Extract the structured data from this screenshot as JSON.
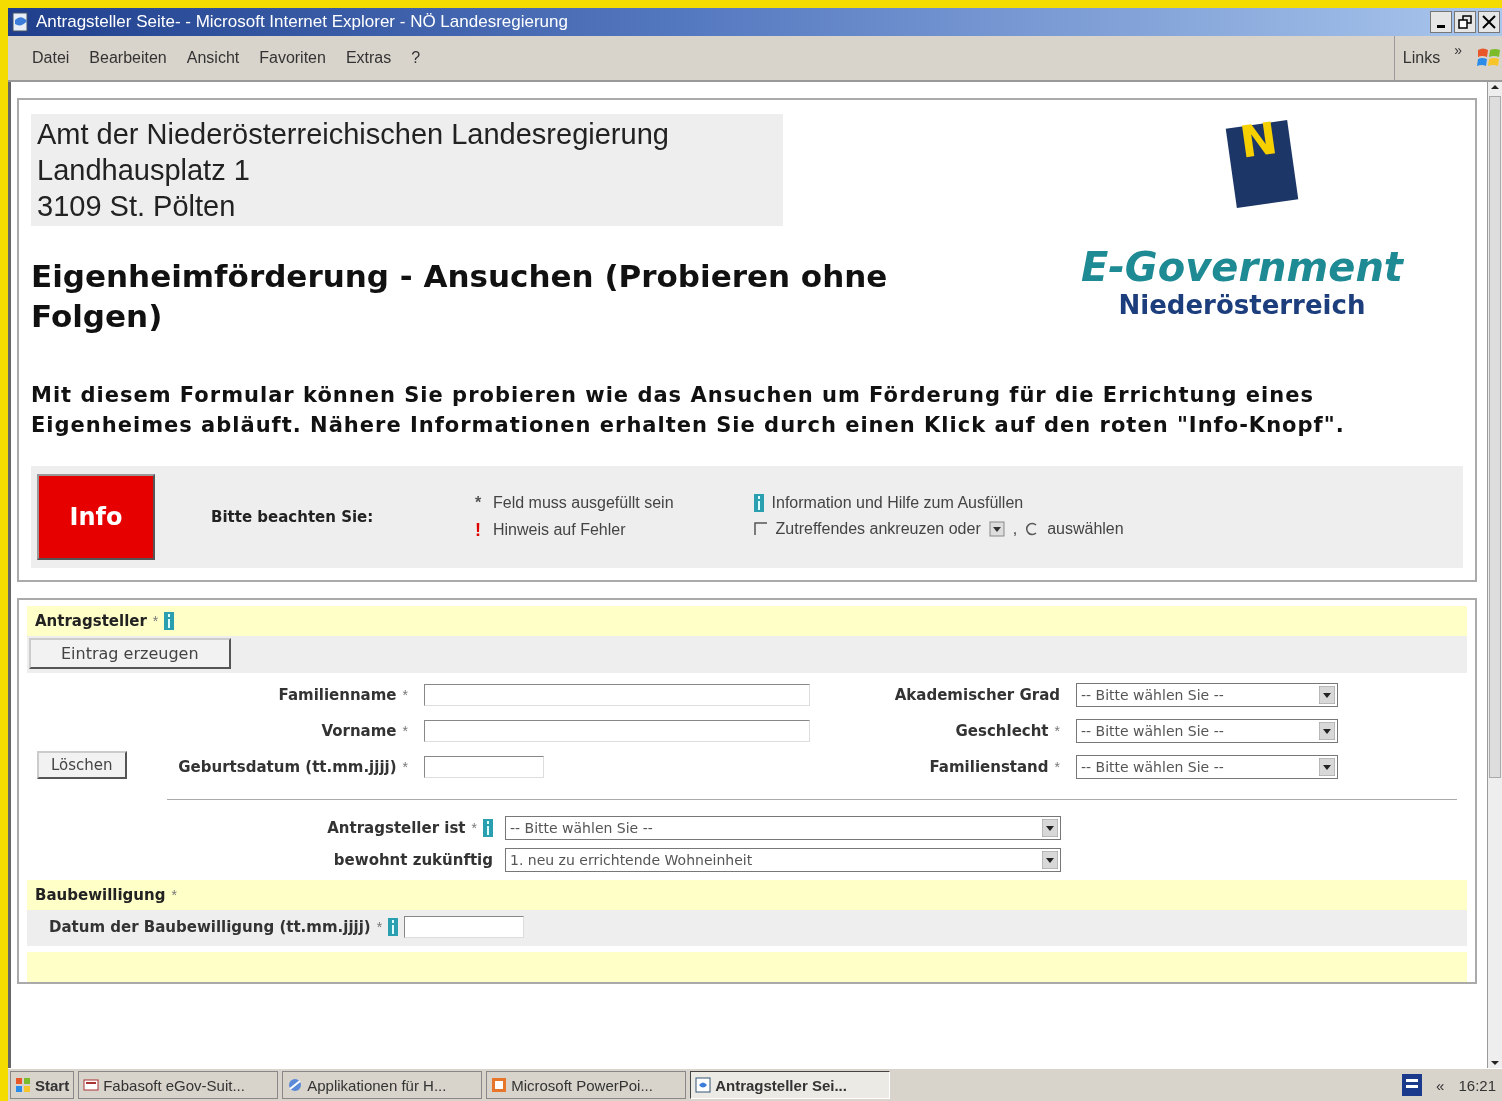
{
  "window": {
    "title": "Antragsteller Seite- - Microsoft Internet Explorer - NÖ Landesregierung"
  },
  "menu": [
    "Datei",
    "Bearbeiten",
    "Ansicht",
    "Favoriten",
    "Extras",
    "?"
  ],
  "links": {
    "label": "Links",
    "chevron": "»"
  },
  "header": {
    "address": [
      "Amt der Niederösterreichischen Landesregierung",
      "Landhausplatz 1",
      "3109 St. Pölten"
    ],
    "logo_letter": "N",
    "title": "Eigenheimförderung - Ansuchen (Probieren ohne Folgen)",
    "brand": "E-Government",
    "brand_sub": "Niederösterreich",
    "intro": "Mit diesem Formular können Sie probieren wie das Ansuchen um Förderung für die Errichtung eines Eigenheimes abläuft. Nähere Informationen erhalten Sie durch einen Klick auf den roten \"Info-Knopf\"."
  },
  "notice": {
    "button": "Info",
    "label": "Bitte beachten Sie:",
    "legend": [
      {
        "kind": "required",
        "marker": "*",
        "text": "Feld muss ausgefüllt sein"
      },
      {
        "kind": "error",
        "marker": "!",
        "text": "Hinweis auf Fehler"
      },
      {
        "kind": "info",
        "text": "Information und Hilfe zum Ausfüllen"
      },
      {
        "kind": "parts",
        "parts": [
          {
            "kind": "checkbox"
          },
          {
            "kind": "text",
            "text": "Zutreffendes ankreuzen oder"
          },
          {
            "kind": "dropdown"
          },
          {
            "kind": "text",
            "text": ","
          },
          {
            "kind": "radio"
          },
          {
            "kind": "text",
            "text": "auswählen"
          }
        ]
      }
    ]
  },
  "applicant": {
    "title": "Antragsteller",
    "mark": "*",
    "info": true,
    "create_button": "Eintrag erzeugen",
    "delete_button": "Löschen",
    "left_fields": [
      {
        "label": "Familienname",
        "mark": "*",
        "kind": "text"
      },
      {
        "label": "Vorname",
        "mark": "*",
        "kind": "text"
      },
      {
        "label": "Geburtsdatum (tt.mm.jjjj)",
        "mark": "*",
        "kind": "date"
      }
    ],
    "right_fields": [
      {
        "label": "Akademischer Grad",
        "kind": "select",
        "value": "-- Bitte wählen Sie --"
      },
      {
        "label": "Geschlecht",
        "mark": "*",
        "kind": "select",
        "value": "-- Bitte wählen Sie --"
      },
      {
        "label": "Familienstand",
        "mark": "*",
        "kind": "select",
        "value": "-- Bitte wählen Sie --"
      }
    ],
    "bottom_fields": [
      {
        "label": "Antragsteller ist",
        "mark": "*",
        "info": true,
        "kind": "select",
        "value": "-- Bitte wählen Sie --"
      },
      {
        "label": "bewohnt zukünftig",
        "info": false,
        "kind": "select",
        "value": "1. neu zu errichtende Wohneinheit"
      }
    ]
  },
  "permit": {
    "title": "Baubewilligung",
    "mark": "*",
    "fields": [
      {
        "label": "Datum der Baubewilligung (tt.mm.jjjj)",
        "mark": "*",
        "info": true,
        "kind": "text"
      }
    ]
  },
  "taskbar": {
    "start": "Start",
    "items": [
      {
        "label": "Fabasoft eGov-Suit...",
        "selected": false
      },
      {
        "label": "Applikationen für H...",
        "selected": false
      },
      {
        "label": "Microsoft PowerPoi...",
        "selected": false
      },
      {
        "label": "Antragsteller Sei...",
        "selected": true
      }
    ],
    "tray_chevron": "«",
    "clock": "16:21"
  }
}
